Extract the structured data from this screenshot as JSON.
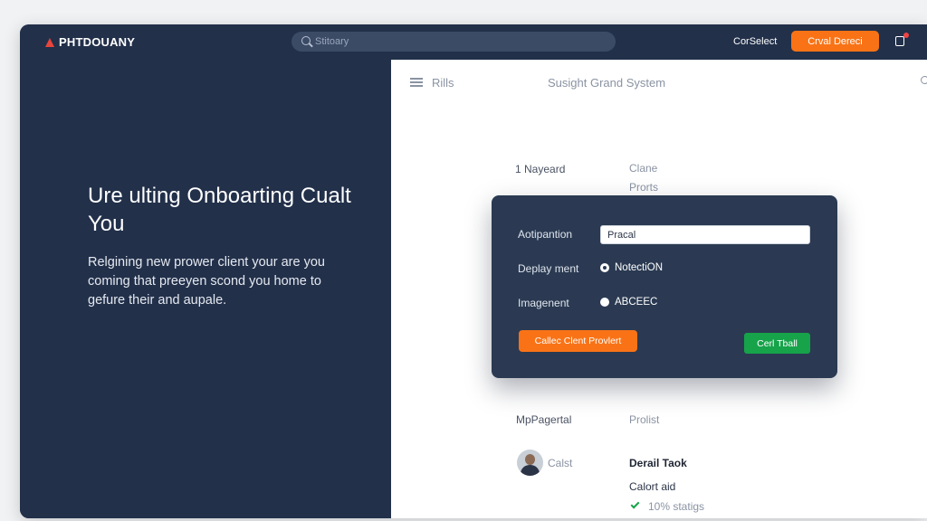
{
  "brand": {
    "name": "PHTDOUANY"
  },
  "search": {
    "placeholder": "Stitoary"
  },
  "topbar": {
    "link": "CorSelect",
    "cta": "Crval Dereci"
  },
  "hero": {
    "title": "Ure ulting Onboarting Cualt You",
    "body": "Relgining new prower client your are you coming that preeyen scond you home to gefure their and aupale."
  },
  "main": {
    "breadcrumb": "Rills",
    "title": "Susight Grand System",
    "rows": [
      {
        "label": "1 Nayeard",
        "value": "Clane"
      },
      {
        "value": "Prorts"
      }
    ]
  },
  "modal": {
    "fields": [
      {
        "label": "Aotipantion",
        "value": "Pracal"
      },
      {
        "label": "Deplay ment",
        "option": "NotectiON",
        "checked": true
      },
      {
        "label": "Imagenent",
        "option": "ABCEEC",
        "checked": false
      }
    ],
    "primary_button": "Callec Clent Provlert",
    "secondary_button": "Cerl Tball"
  },
  "lower": {
    "section_label": "MpPagertal",
    "section_value": "Prolist",
    "avatar_label": "Calst",
    "task_title": "Derail Taok",
    "task_sub": "Calort aid",
    "task_status": "10% statigs"
  },
  "colors": {
    "accent": "#f97316",
    "success": "#16a34a",
    "navy": "#22304a"
  }
}
